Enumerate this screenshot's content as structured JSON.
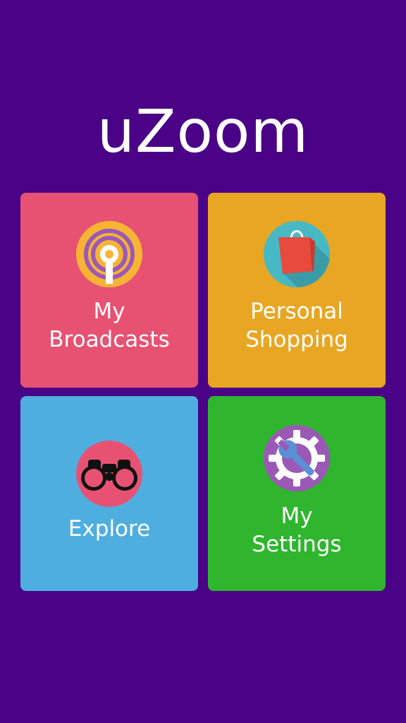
{
  "app": {
    "logo_text": "uZoom"
  },
  "tiles": [
    {
      "label": "My\nBroadcasts",
      "icon": "broadcast-icon",
      "color": "#e75272"
    },
    {
      "label": "Personal\nShopping",
      "icon": "shopping-bag-icon",
      "color": "#e8a623"
    },
    {
      "label": "Explore",
      "icon": "binoculars-icon",
      "color": "#4eaee0"
    },
    {
      "label": "My\nSettings",
      "icon": "settings-gear-wrench-icon",
      "color": "#30b52f"
    }
  ],
  "colors": {
    "background": "#4a0386",
    "text": "#ffffff"
  }
}
